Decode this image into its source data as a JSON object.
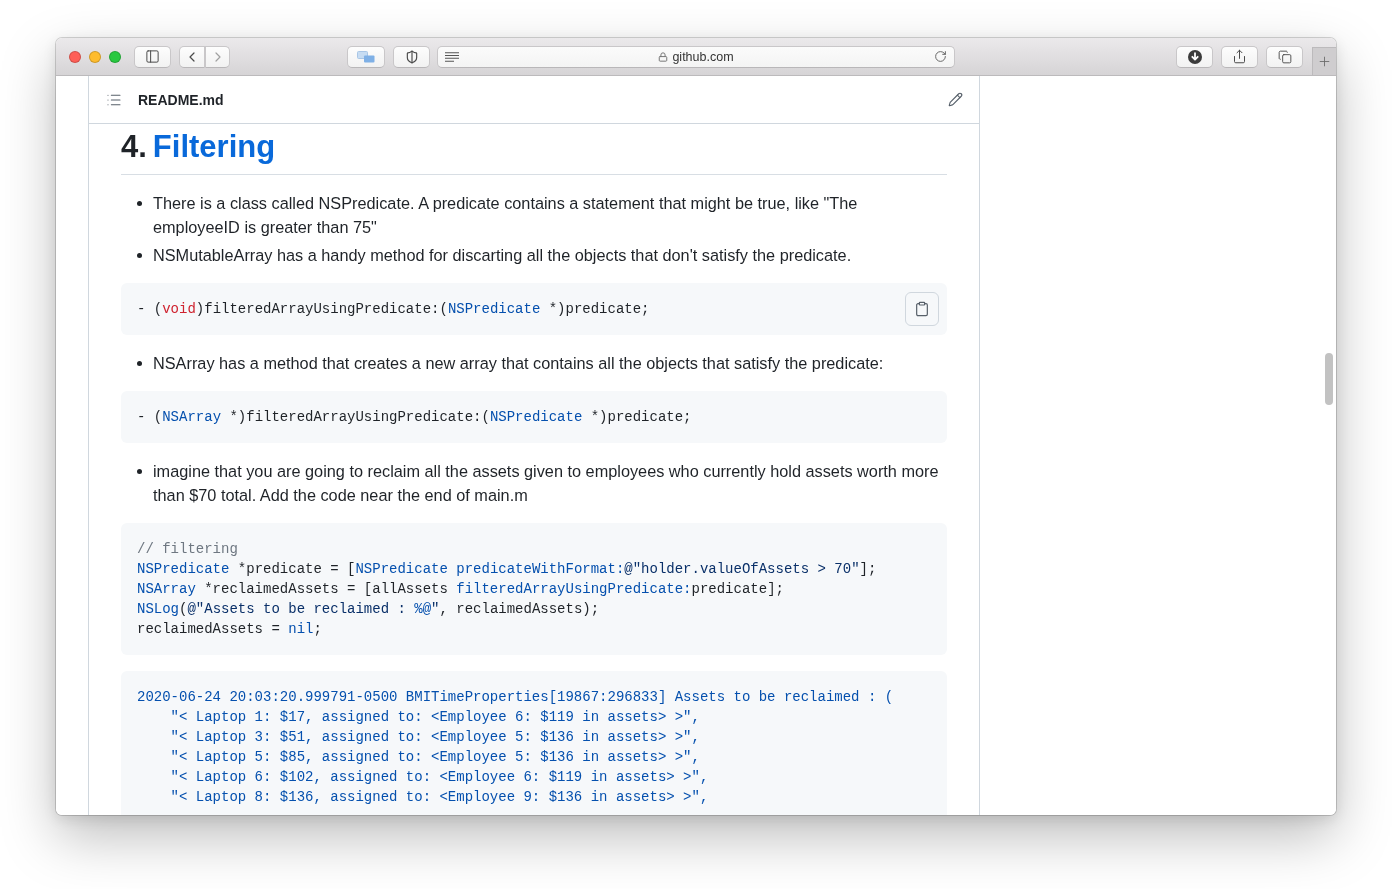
{
  "window": {
    "address": "github.com"
  },
  "file_header": {
    "title": "README.md"
  },
  "article": {
    "heading": {
      "number": "4.",
      "link": "Filtering"
    },
    "blocks": [
      {
        "kind": "list",
        "items": [
          "There is a class called NSPredicate. A predicate contains a statement that might be true, like \"The employeeID is greater than 75\"",
          "NSMutableArray has a handy method for discarting all the objects that don't satisfy the predicate."
        ]
      },
      {
        "kind": "code",
        "copy_button": true,
        "lines": [
          [
            {
              "text": "- (",
              "kind": "plain"
            },
            {
              "text": "void",
              "kind": "keyword"
            },
            {
              "text": ")filteredArrayUsingPredicate:(",
              "kind": "plain"
            },
            {
              "text": "NSPredicate",
              "kind": "constant"
            },
            {
              "text": " *)predicate;",
              "kind": "plain"
            }
          ]
        ]
      },
      {
        "kind": "list",
        "items": [
          "NSArray has a method that creates a new array that contains all the objects that satisfy the predicate:"
        ]
      },
      {
        "kind": "code",
        "copy_button": false,
        "lines": [
          [
            {
              "text": "- (",
              "kind": "plain"
            },
            {
              "text": "NSArray",
              "kind": "constant"
            },
            {
              "text": " *)filteredArrayUsingPredicate:(",
              "kind": "plain"
            },
            {
              "text": "NSPredicate",
              "kind": "constant"
            },
            {
              "text": " *)predicate;",
              "kind": "plain"
            }
          ]
        ]
      },
      {
        "kind": "list",
        "items": [
          "imagine that you are going to reclaim all the assets given to employees who currently hold assets worth more than $70 total. Add the code near the end of main.m"
        ]
      },
      {
        "kind": "code",
        "copy_button": false,
        "lines": [
          [
            {
              "text": "// filtering",
              "kind": "comment"
            }
          ],
          [
            {
              "text": "NSPredicate",
              "kind": "constant"
            },
            {
              "text": " *predicate = [",
              "kind": "plain"
            },
            {
              "text": "NSPredicate predicateWithFormat:",
              "kind": "constant"
            },
            {
              "text": "@\"holder.valueOfAssets > 70\"",
              "kind": "string"
            },
            {
              "text": "];",
              "kind": "plain"
            }
          ],
          [
            {
              "text": "NSArray",
              "kind": "constant"
            },
            {
              "text": " *reclaimedAssets = [allAssets ",
              "kind": "plain"
            },
            {
              "text": "filteredArrayUsingPredicate:",
              "kind": "constant"
            },
            {
              "text": "predicate];",
              "kind": "plain"
            }
          ],
          [
            {
              "text": "NSLog",
              "kind": "constant"
            },
            {
              "text": "(",
              "kind": "plain"
            },
            {
              "text": "@\"Assets to be reclaimed : ",
              "kind": "string"
            },
            {
              "text": "%@",
              "kind": "constant"
            },
            {
              "text": "\"",
              "kind": "string"
            },
            {
              "text": ", reclaimedAssets);",
              "kind": "plain"
            }
          ],
          [
            {
              "text": "reclaimedAssets = ",
              "kind": "plain"
            },
            {
              "text": "nil",
              "kind": "constant"
            },
            {
              "text": ";",
              "kind": "plain"
            }
          ]
        ]
      },
      {
        "kind": "code",
        "copy_button": false,
        "lines": [
          [
            {
              "text": "2020-06-24 20:03:20.999791-0500 BMITimeProperties[19867:296833] Assets to be reclaimed : (",
              "kind": "constant"
            }
          ],
          [
            {
              "text": "    \"< Laptop 1: $17, assigned to: <Employee 6: $119 in assets> >\",",
              "kind": "constant"
            }
          ],
          [
            {
              "text": "    \"< Laptop 3: $51, assigned to: <Employee 5: $136 in assets> >\",",
              "kind": "constant"
            }
          ],
          [
            {
              "text": "    \"< Laptop 5: $85, assigned to: <Employee 5: $136 in assets> >\",",
              "kind": "constant"
            }
          ],
          [
            {
              "text": "    \"< Laptop 6: $102, assigned to: <Employee 6: $119 in assets> >\",",
              "kind": "constant"
            }
          ],
          [
            {
              "text": "    \"< Laptop 8: $136, assigned to: <Employee 9: $136 in assets> >\",",
              "kind": "constant"
            }
          ]
        ]
      }
    ]
  }
}
